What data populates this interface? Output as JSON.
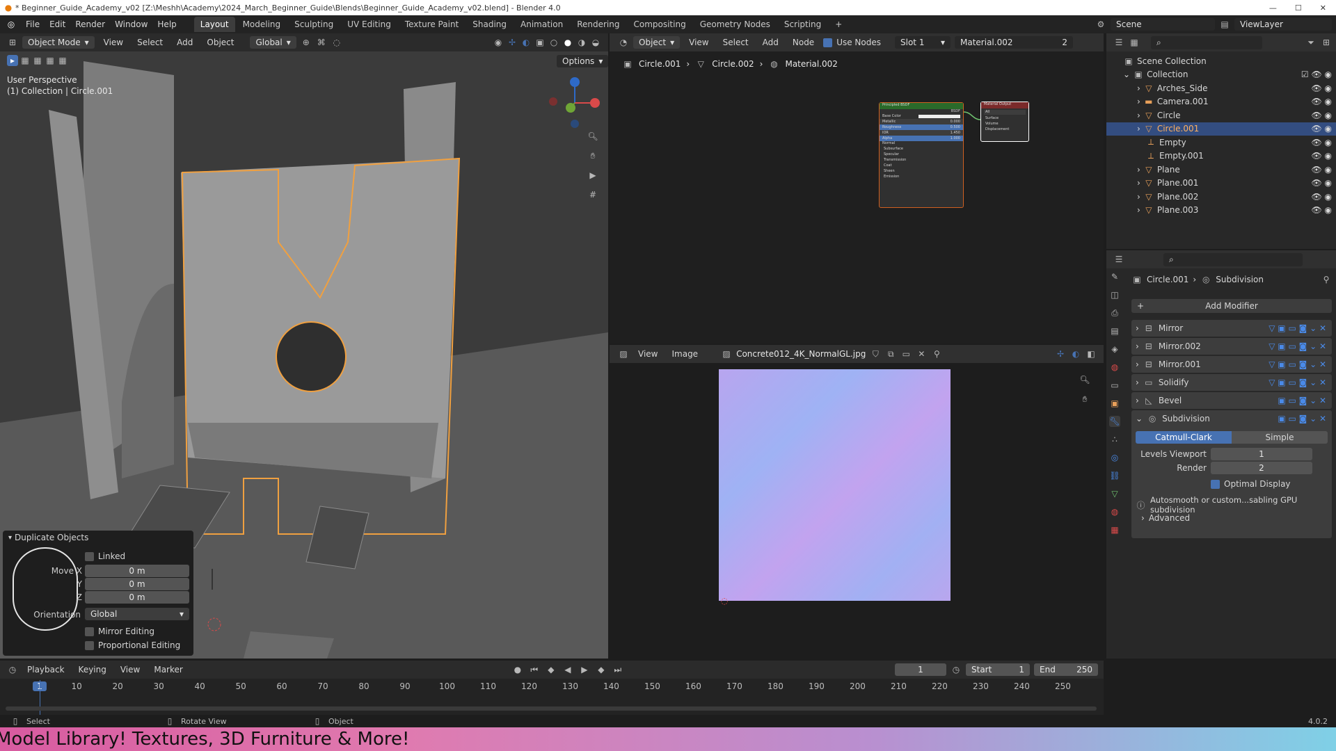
{
  "titlebar": {
    "title": "* Beginner_Guide_Academy_v02 [Z:\\Meshh\\Academy\\2024_March_Beginner_Guide\\Blends\\Beginner_Guide_Academy_v02.blend] - Blender 4.0"
  },
  "menu": [
    "File",
    "Edit",
    "Render",
    "Window",
    "Help"
  ],
  "workspaces": [
    "Layout",
    "Modeling",
    "Sculpting",
    "UV Editing",
    "Texture Paint",
    "Shading",
    "Animation",
    "Rendering",
    "Compositing",
    "Geometry Nodes",
    "Scripting"
  ],
  "active_workspace": "Layout",
  "scene": "Scene",
  "view_layer": "ViewLayer",
  "viewport": {
    "mode": "Object Mode",
    "menus": [
      "View",
      "Select",
      "Add",
      "Object"
    ],
    "transform": "Global",
    "options": "Options",
    "perspective": "User Perspective",
    "collection_label": "(1) Collection | Circle.001",
    "panel": {
      "title": "Duplicate Objects",
      "linked": "Linked",
      "move_label": "Move X",
      "move_x": "0 m",
      "move_y": "0 m",
      "move_z": "0 m",
      "y_label": "Y",
      "z_label": "Z",
      "orientation_label": "Orientation",
      "orientation": "Global",
      "mirror": "Mirror Editing",
      "proportional": "Proportional Editing"
    }
  },
  "node_editor": {
    "object": "Object",
    "menus": [
      "View",
      "Select",
      "Add",
      "Node"
    ],
    "use_nodes": "Use Nodes",
    "slot": "Slot 1",
    "material": "Material.002",
    "users": "2",
    "breadcrumb": [
      "Circle.001",
      "Circle.002",
      "Material.002"
    ],
    "bsdf_title": "Principled BSDF",
    "bsdf_out": "BSDF",
    "bsdf_fields": [
      {
        "label": "Base Color",
        "value": ""
      },
      {
        "label": "Metallic",
        "value": "0.000"
      },
      {
        "label": "Roughness",
        "value": "0.500"
      },
      {
        "label": "IOR",
        "value": "1.450"
      },
      {
        "label": "Alpha",
        "value": "1.000"
      }
    ],
    "bsdf_sections": [
      "Normal",
      "Subsurface",
      "Specular",
      "Transmission",
      "Coat",
      "Sheen",
      "Emission"
    ],
    "output_title": "Material Output",
    "output_target": "All",
    "output_sockets": [
      "Surface",
      "Volume",
      "Displacement"
    ]
  },
  "image_editor": {
    "menus": [
      "View",
      "Image"
    ],
    "image_name": "Concrete012_4K_NormalGL.jpg"
  },
  "outliner": {
    "root": "Scene Collection",
    "collection": "Collection",
    "items": [
      "Arches_Side",
      "Camera.001",
      "Circle",
      "Circle.001",
      "Empty",
      "Empty.001",
      "Plane",
      "Plane.001",
      "Plane.002",
      "Plane.003"
    ],
    "selected": "Circle.001"
  },
  "properties": {
    "object": "Circle.001",
    "modifier": "Subdivision",
    "add_modifier": "Add Modifier",
    "modifiers": [
      "Mirror",
      "Mirror.002",
      "Mirror.001",
      "Solidify",
      "Bevel",
      "Subdivision"
    ],
    "catmull": "Catmull-Clark",
    "simple": "Simple",
    "levels_label": "Levels Viewport",
    "levels": "1",
    "render_label": "Render",
    "render": "2",
    "optimal": "Optimal Display",
    "info": "Autosmooth or custom...sabling GPU subdivision",
    "advanced": "Advanced"
  },
  "timeline": {
    "menus": [
      "Playback",
      "Keying",
      "View",
      "Marker"
    ],
    "current": "1",
    "start_label": "Start",
    "start": "1",
    "end_label": "End",
    "end": "250",
    "ticks": [
      "1",
      "10",
      "20",
      "30",
      "40",
      "50",
      "60",
      "70",
      "80",
      "90",
      "100",
      "110",
      "120",
      "130",
      "140",
      "150",
      "160",
      "170",
      "180",
      "190",
      "200",
      "210",
      "220",
      "230",
      "240",
      "250"
    ]
  },
  "status": {
    "select": "Select",
    "rotate": "Rotate View",
    "object": "Object",
    "version": "4.0.2"
  },
  "banner": {
    "text": "Model Library! Textures, 3D Furniture & More!"
  },
  "colors": {
    "accent": "#4772b3",
    "selected_outline": "#f0a040",
    "banner_start": "#d85ba0",
    "banner_end": "#7fd0e6"
  }
}
